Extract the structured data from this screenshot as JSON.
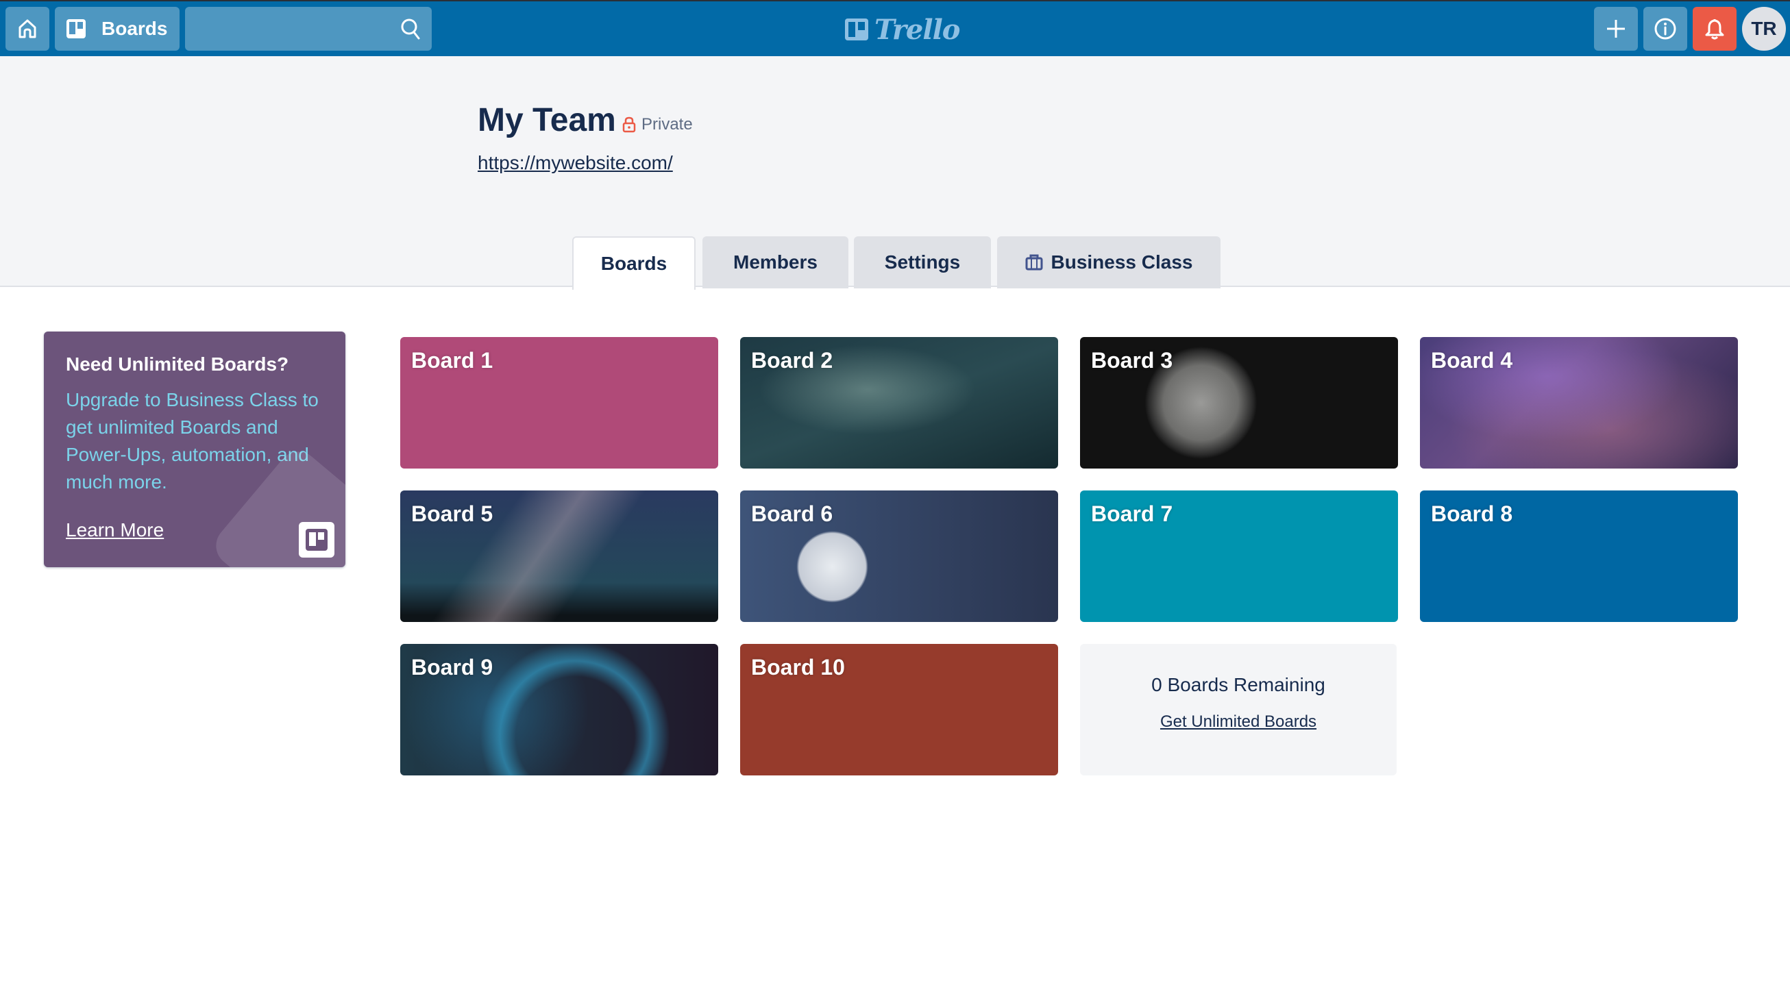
{
  "header": {
    "home_icon": "home-icon",
    "boards_label": "Boards",
    "boards_icon": "board-icon",
    "search": {
      "value": "",
      "placeholder": "",
      "icon": "search-icon"
    },
    "logo_text": "Trello",
    "add_icon": "plus-icon",
    "info_icon": "info-icon",
    "notifications_icon": "bell-icon",
    "avatar_initials": "TR",
    "colors": {
      "bar": "#026aa7",
      "notification": "#eb5a46"
    }
  },
  "team": {
    "name": "My Team",
    "privacy": "Private",
    "privacy_icon": "lock-icon",
    "website": "https://mywebsite.com/"
  },
  "tabs": [
    {
      "label": "Boards",
      "active": true
    },
    {
      "label": "Members",
      "active": false
    },
    {
      "label": "Settings",
      "active": false
    },
    {
      "label": "Business Class",
      "active": false,
      "icon": "briefcase-icon"
    }
  ],
  "upgrade": {
    "title": "Need Unlimited Boards?",
    "body": "Upgrade to Business Class to get unlimited Boards and Power-Ups, automation, and much more.",
    "link": "Learn More",
    "background": "#6c547b"
  },
  "boards": [
    {
      "title": "Board 1",
      "background": "#b04a78"
    },
    {
      "title": "Board 2",
      "background": "galaxy-teal-photo"
    },
    {
      "title": "Board 3",
      "background": "moon-dark-photo"
    },
    {
      "title": "Board 4",
      "background": "nebula-purple-photo"
    },
    {
      "title": "Board 5",
      "background": "milky-way-photo"
    },
    {
      "title": "Board 6",
      "background": "moon-blue-photo"
    },
    {
      "title": "Board 7",
      "background": "#0094af"
    },
    {
      "title": "Board 8",
      "background": "#0067a3"
    },
    {
      "title": "Board 9",
      "background": "bubble-nebula-photo"
    },
    {
      "title": "Board 10",
      "background": "#963b2c"
    }
  ],
  "remaining": {
    "count_text": "0 Boards Remaining",
    "link": "Get Unlimited Boards"
  }
}
